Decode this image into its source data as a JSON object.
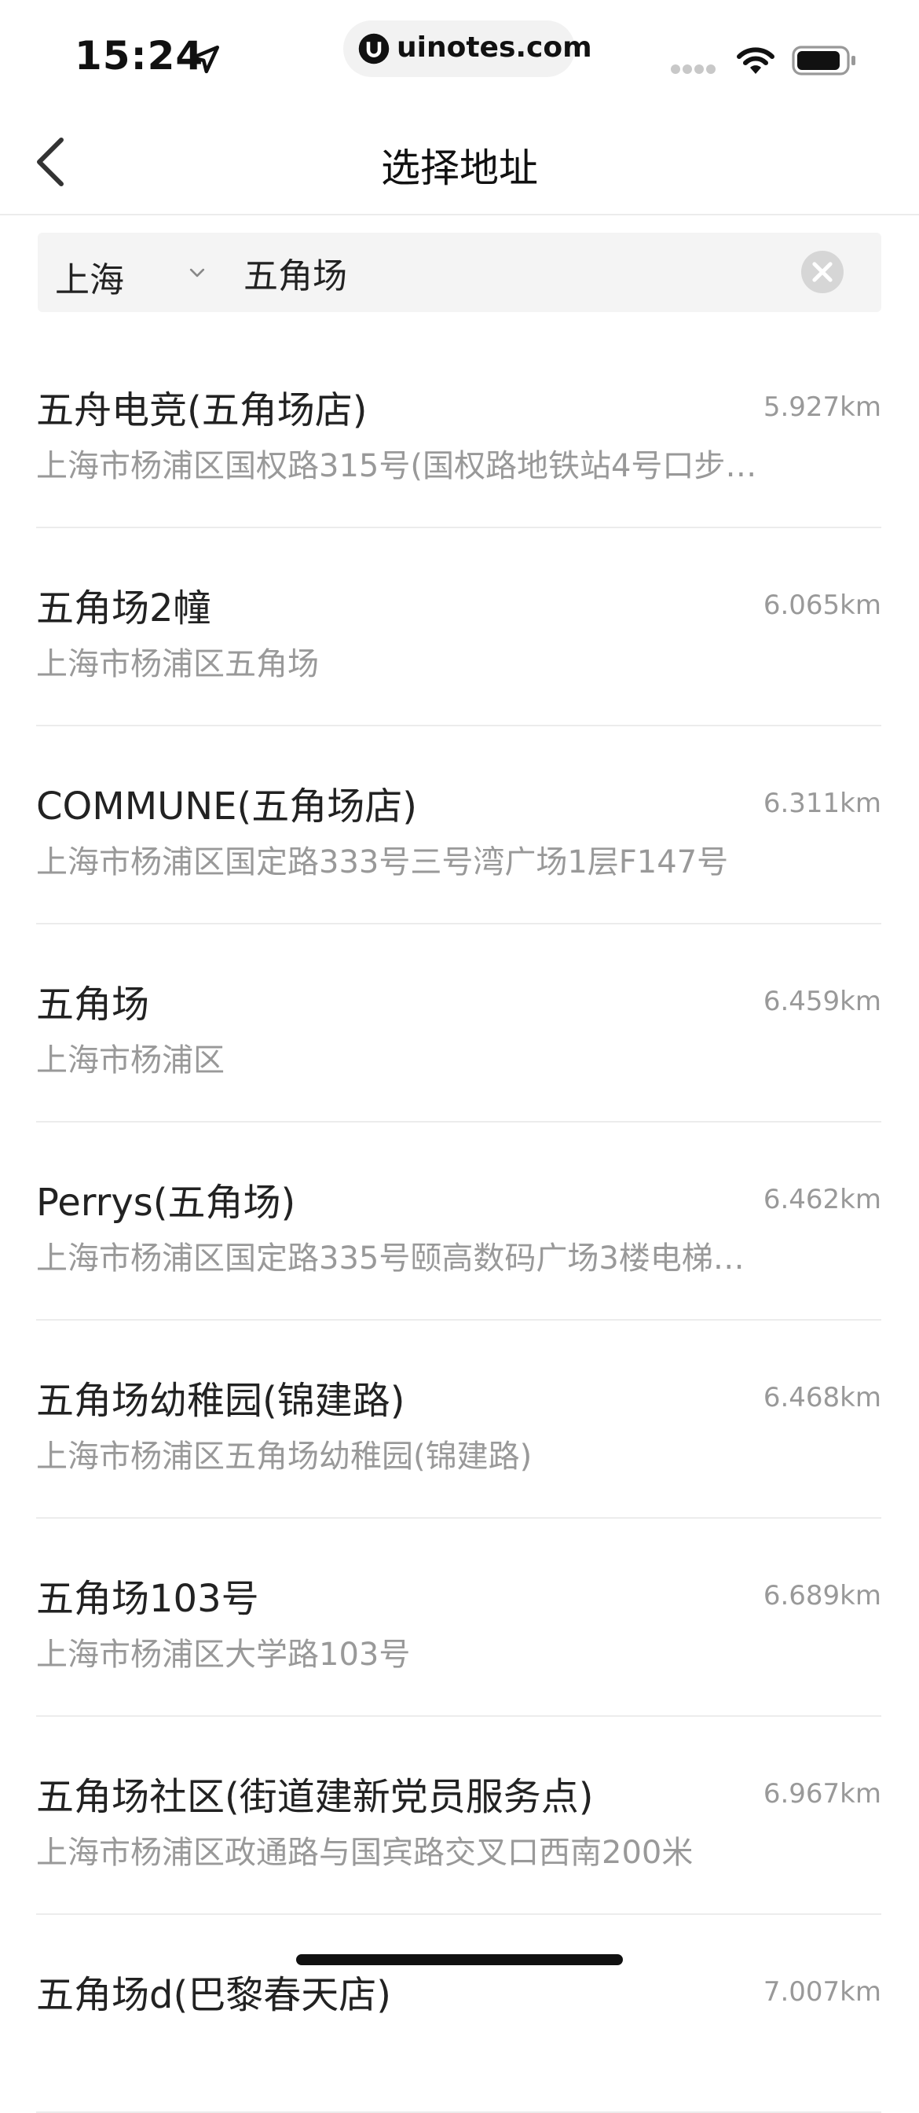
{
  "status_bar": {
    "time": "15:24",
    "url": "uinotes.com"
  },
  "nav": {
    "title": "选择地址"
  },
  "search": {
    "city": "上海",
    "query": "五角场",
    "placeholder": ""
  },
  "results": [
    {
      "name": "五舟电竞(五角场店)",
      "address": "上海市杨浦区国权路315号(国权路地铁站4号口步…",
      "distance": "5.927km"
    },
    {
      "name": "五角场2幢",
      "address": "上海市杨浦区五角场",
      "distance": "6.065km"
    },
    {
      "name": "COMMUNE(五角场店)",
      "address": "上海市杨浦区国定路333号三号湾广场1层F147号",
      "distance": "6.311km"
    },
    {
      "name": "五角场",
      "address": "上海市杨浦区",
      "distance": "6.459km"
    },
    {
      "name": "Perrys(五角场)",
      "address": "上海市杨浦区国定路335号颐高数码广场3楼电梯…",
      "distance": "6.462km"
    },
    {
      "name": "五角场幼稚园(锦建路)",
      "address": "上海市杨浦区五角场幼稚园(锦建路)",
      "distance": "6.468km"
    },
    {
      "name": "五角场103号",
      "address": "上海市杨浦区大学路103号",
      "distance": "6.689km"
    },
    {
      "name": "五角场社区(街道建新党员服务点)",
      "address": "上海市杨浦区政通路与国宾路交叉口西南200米",
      "distance": "6.967km"
    },
    {
      "name": "五角场d(巴黎春天店)",
      "address": "",
      "distance": "7.007km"
    }
  ]
}
